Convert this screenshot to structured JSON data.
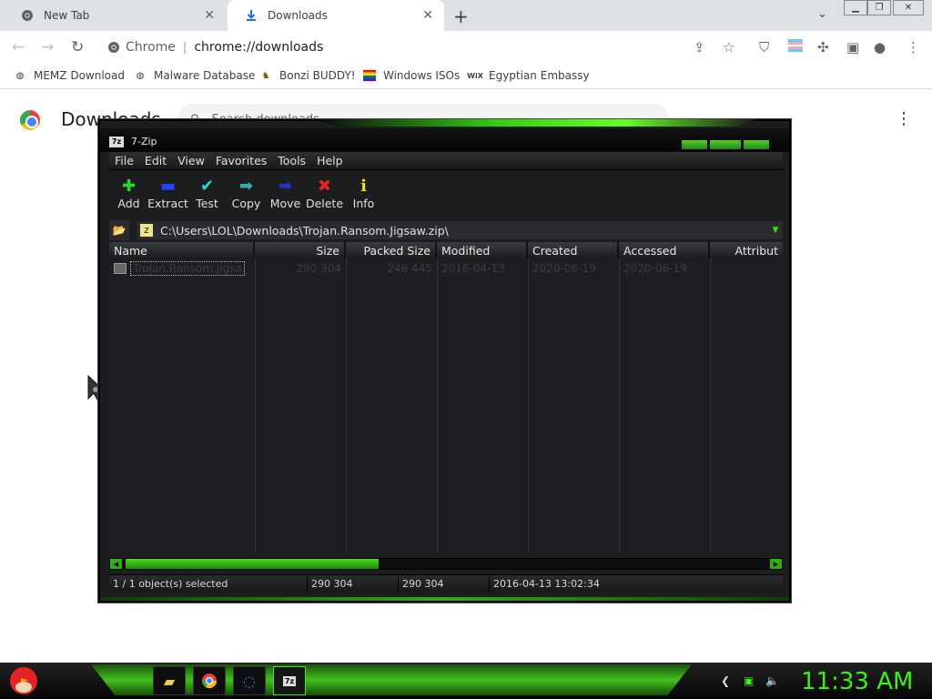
{
  "browser": {
    "tabs": [
      {
        "label": "New Tab",
        "icon": "chrome-icon"
      },
      {
        "label": "Downloads",
        "icon": "download-icon"
      }
    ],
    "close_glyph": "✕",
    "new_tab_glyph": "+",
    "omnibox": {
      "chip": "Chrome",
      "url": "chrome://downloads"
    },
    "bookmarks": [
      {
        "label": "MEMZ Download",
        "icon": "globe-icon"
      },
      {
        "label": "Malware Database",
        "icon": "globe-icon"
      },
      {
        "label": "Bonzi BUDDY!",
        "icon": "bonzi-icon"
      },
      {
        "label": "Windows ISOs",
        "icon": "rainbow-icon"
      },
      {
        "label": "Egyptian Embassy",
        "icon": "wix-icon"
      }
    ]
  },
  "downloads_page": {
    "title": "Downloads",
    "search_placeholder": "Search downloads"
  },
  "sevenzip": {
    "title": "7-Zip",
    "menu": [
      "File",
      "Edit",
      "View",
      "Favorites",
      "Tools",
      "Help"
    ],
    "toolbar": [
      {
        "label": "Add",
        "glyph": "✚",
        "color": "#22dd22"
      },
      {
        "label": "Extract",
        "glyph": "▬",
        "color": "#2244ff"
      },
      {
        "label": "Test",
        "glyph": "✔",
        "color": "#22dddd"
      },
      {
        "label": "Copy",
        "glyph": "➡",
        "color": "#33aaaa"
      },
      {
        "label": "Move",
        "glyph": "➡",
        "color": "#2233cc"
      },
      {
        "label": "Delete",
        "glyph": "✖",
        "color": "#ee2222"
      },
      {
        "label": "Info",
        "glyph": "i",
        "color": "#eedd22"
      }
    ],
    "path": "C:\\Users\\LOL\\Downloads\\Trojan.Ransom.Jigsaw.zip\\",
    "columns": [
      "Name",
      "Size",
      "Packed Size",
      "Modified",
      "Created",
      "Accessed",
      "Attribut"
    ],
    "rows": [
      {
        "name": "Trojan.Ransom.Jigsa",
        "size": "290 304",
        "packed": "246 445",
        "modified": "2016-04-13",
        "created": "2020-06-19",
        "accessed": "2020-06-19",
        "attrib": ""
      }
    ],
    "status": {
      "selected": "1 / 1 object(s) selected",
      "size": "290 304",
      "packed": "290 304",
      "modified": "2016-04-13 13:02:34"
    }
  },
  "taskbar": {
    "clock": "11:33 AM",
    "accent": "#49e020"
  }
}
